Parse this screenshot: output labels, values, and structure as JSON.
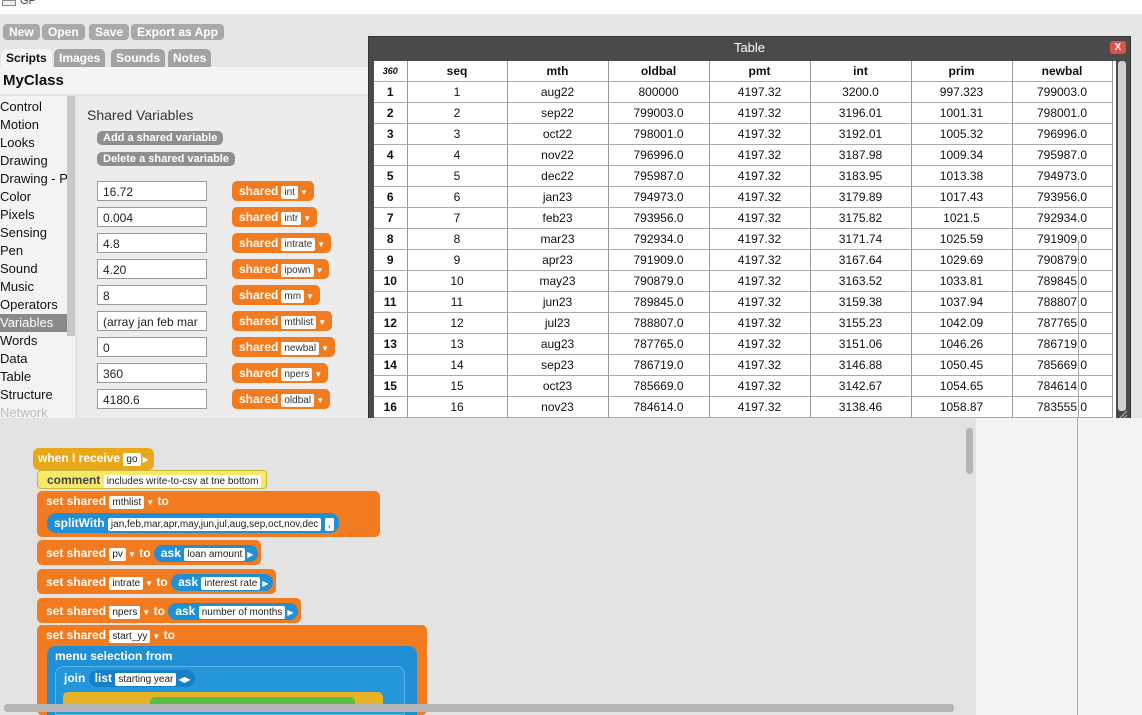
{
  "window": {
    "title": "GP"
  },
  "toolbar": {
    "buttons": [
      "New",
      "Open",
      "Save",
      "Export as App"
    ]
  },
  "tabs": [
    "Scripts",
    "Images",
    "Sounds",
    "Notes"
  ],
  "class_name": "MyClass",
  "categories": [
    "Control",
    "Motion",
    "Looks",
    "Drawing",
    "Drawing - Paths",
    "Color",
    "Pixels",
    "Sensing",
    "Pen",
    "Sound",
    "Music",
    "Operators",
    "Variables",
    "Words",
    "Data",
    "Table",
    "Structure",
    "Network"
  ],
  "selected_category": "Variables",
  "palette": {
    "title": "Shared Variables",
    "add_button": "Add a shared variable",
    "delete_button": "Delete a shared variable",
    "shared_label": "shared",
    "variables": [
      {
        "value": "16.72",
        "name": "int"
      },
      {
        "value": "0.004",
        "name": "intr"
      },
      {
        "value": "4.8",
        "name": "intrate"
      },
      {
        "value": "4.20",
        "name": "ipown"
      },
      {
        "value": "8",
        "name": "mm"
      },
      {
        "value": "(array jan feb mar",
        "name": "mthlist"
      },
      {
        "value": "0",
        "name": "newbal"
      },
      {
        "value": "360",
        "name": "npers"
      },
      {
        "value": "4180.6",
        "name": "oldbal"
      }
    ]
  },
  "table": {
    "title": "Table",
    "close_label": "X",
    "row_count": "360",
    "columns": [
      "seq",
      "mth",
      "oldbal",
      "pmt",
      "int",
      "prim",
      "newbal"
    ],
    "rows": [
      [
        "1",
        "1",
        "aug22",
        "800000",
        "4197.32",
        "3200.0",
        "997.323",
        "799003.0"
      ],
      [
        "2",
        "2",
        "sep22",
        "799003.0",
        "4197.32",
        "3196.01",
        "1001.31",
        "798001.0"
      ],
      [
        "3",
        "3",
        "oct22",
        "798001.0",
        "4197.32",
        "3192.01",
        "1005.32",
        "796996.0"
      ],
      [
        "4",
        "4",
        "nov22",
        "796996.0",
        "4197.32",
        "3187.98",
        "1009.34",
        "795987.0"
      ],
      [
        "5",
        "5",
        "dec22",
        "795987.0",
        "4197.32",
        "3183.95",
        "1013.38",
        "794973.0"
      ],
      [
        "6",
        "6",
        "jan23",
        "794973.0",
        "4197.32",
        "3179.89",
        "1017.43",
        "793956.0"
      ],
      [
        "7",
        "7",
        "feb23",
        "793956.0",
        "4197.32",
        "3175.82",
        "1021.5",
        "792934.0"
      ],
      [
        "8",
        "8",
        "mar23",
        "792934.0",
        "4197.32",
        "3171.74",
        "1025.59",
        "791909.0"
      ],
      [
        "9",
        "9",
        "apr23",
        "791909.0",
        "4197.32",
        "3167.64",
        "1029.69",
        "790879.0"
      ],
      [
        "10",
        "10",
        "may23",
        "790879.0",
        "4197.32",
        "3163.52",
        "1033.81",
        "789845.0"
      ],
      [
        "11",
        "11",
        "jun23",
        "789845.0",
        "4197.32",
        "3159.38",
        "1037.94",
        "788807.0"
      ],
      [
        "12",
        "12",
        "jul23",
        "788807.0",
        "4197.32",
        "3155.23",
        "1042.09",
        "787765.0"
      ],
      [
        "13",
        "13",
        "aug23",
        "787765.0",
        "4197.32",
        "3151.06",
        "1046.26",
        "786719.0"
      ],
      [
        "14",
        "14",
        "sep23",
        "786719.0",
        "4197.32",
        "3146.88",
        "1050.45",
        "785669.0"
      ],
      [
        "15",
        "15",
        "oct23",
        "785669.0",
        "4197.32",
        "3142.67",
        "1054.65",
        "784614.0"
      ],
      [
        "16",
        "16",
        "nov23",
        "784614.0",
        "4197.32",
        "3138.46",
        "1058.87",
        "783555.0"
      ]
    ]
  },
  "script": {
    "hat": {
      "label": "when I receive",
      "value": "go"
    },
    "comment": {
      "label": "comment",
      "value": "includes write-to-csv at tne bottom"
    },
    "set_mthlist": {
      "label": "set shared",
      "var": "mthlist",
      "to": "to"
    },
    "splitwith": {
      "label": "splitWith",
      "value": "jan,feb,mar,apr,may,jun,jul,aug,sep,oct,nov,dec",
      "sep": ","
    },
    "set_pv": {
      "label": "set shared",
      "var": "pv",
      "to": "to",
      "ask": "ask",
      "prompt": "loan amount"
    },
    "set_intrate": {
      "label": "set shared",
      "var": "intrate",
      "to": "to",
      "ask": "ask",
      "prompt": "interest rate"
    },
    "set_npers": {
      "label": "set shared",
      "var": "npers",
      "to": "to",
      "ask": "ask",
      "prompt": "number of months"
    },
    "set_start": {
      "label": "set shared",
      "var": "start_yy",
      "to": "to"
    },
    "menu": {
      "label": "menu selection from"
    },
    "join": {
      "label": "join",
      "list": "list",
      "value": "starting year"
    }
  },
  "colors": {
    "control_hat": "#e8a81a",
    "variables_orange": "#f27a1f",
    "words_blue": "#1f8fd6",
    "comment_yellow": "#f7e86a"
  }
}
